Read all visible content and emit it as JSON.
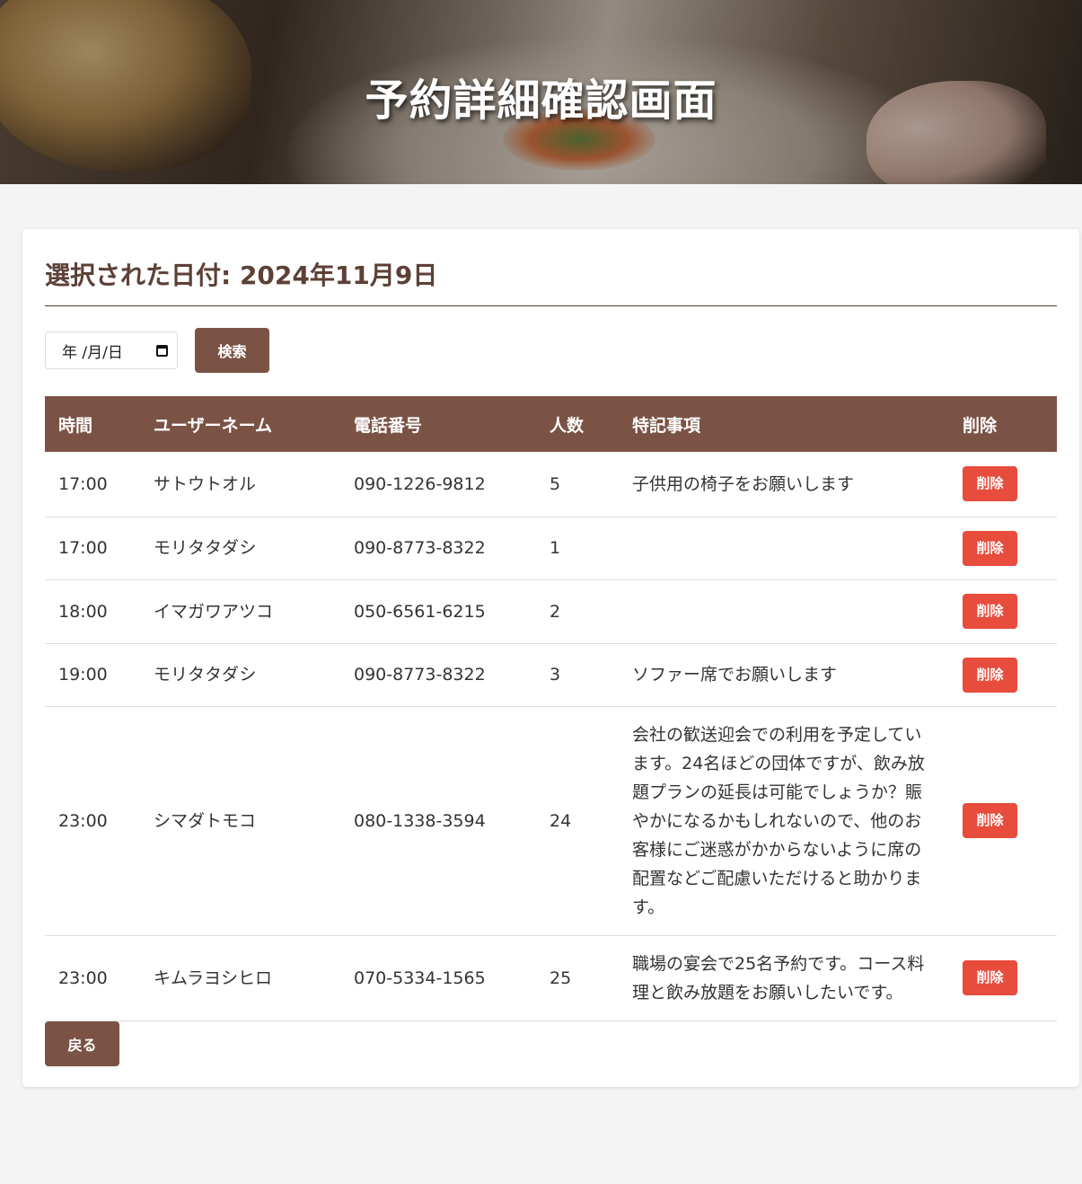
{
  "header": {
    "title": "予約詳細確認画面"
  },
  "selected_date_label": "選択された日付: 2024年11月9日",
  "search": {
    "date_placeholder": "年 /月/日",
    "search_label": "検索"
  },
  "table": {
    "headers": [
      "時間",
      "ユーザーネーム",
      "電話番号",
      "人数",
      "特記事項",
      "削除"
    ],
    "rows": [
      {
        "time": "17:00",
        "name": "サトウトオル",
        "phone": "090-1226-9812",
        "people": "5",
        "notes": "子供用の椅子をお願いします",
        "delete_label": "削除"
      },
      {
        "time": "17:00",
        "name": "モリタタダシ",
        "phone": "090-8773-8322",
        "people": "1",
        "notes": "",
        "delete_label": "削除"
      },
      {
        "time": "18:00",
        "name": "イマガワアツコ",
        "phone": "050-6561-6215",
        "people": "2",
        "notes": "",
        "delete_label": "削除"
      },
      {
        "time": "19:00",
        "name": "モリタタダシ",
        "phone": "090-8773-8322",
        "people": "3",
        "notes": "ソファー席でお願いします",
        "delete_label": "削除"
      },
      {
        "time": "23:00",
        "name": "シマダトモコ",
        "phone": "080-1338-3594",
        "people": "24",
        "notes": "会社の歓送迎会での利用を予定しています。24名ほどの団体ですが、飲み放題プランの延長は可能でしょうか？賑やかになるかもしれないので、他のお客様にご迷惑がかからないように席の配置などご配慮いただけると助かります。",
        "delete_label": "削除"
      },
      {
        "time": "23:00",
        "name": "キムラヨシヒロ",
        "phone": "070-5334-1565",
        "people": "25",
        "notes": "職場の宴会で25名予約です。コース料理と飲み放題をお願いしたいです。",
        "delete_label": "削除"
      }
    ]
  },
  "back_label": "戻る",
  "colors": {
    "brown": "#7b5345",
    "delete_red": "#e74c3c",
    "title_brown": "#5d4037"
  },
  "icons": [
    "calendar-icon"
  ]
}
